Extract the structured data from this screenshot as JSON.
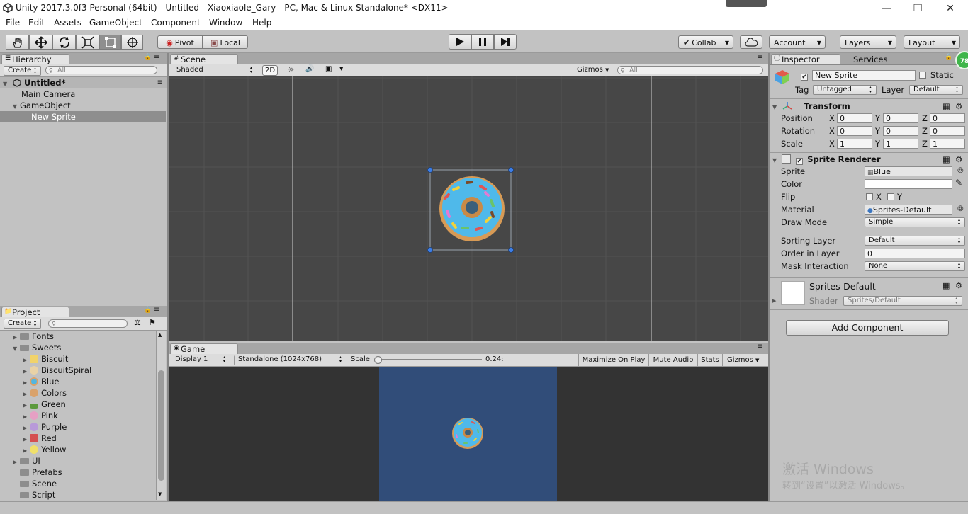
{
  "window": {
    "title": "Unity 2017.3.0f3 Personal (64bit) - Untitled - Xiaoxiaole_Gary - PC, Mac & Linux Standalone* <DX11>",
    "minimize": "—",
    "maximize": "❐",
    "close": "✕"
  },
  "menu": [
    "File",
    "Edit",
    "Assets",
    "GameObject",
    "Component",
    "Window",
    "Help"
  ],
  "toolbar": {
    "pivot": "Pivot",
    "local": "Local",
    "collab": "Collab",
    "account": "Account",
    "layers": "Layers",
    "layout": "Layout"
  },
  "hierarchy": {
    "tab": "Hierarchy",
    "create": "Create",
    "search_placeholder": "All",
    "scene_name": "Untitled*",
    "items": [
      {
        "label": "Main Camera"
      },
      {
        "label": "GameObject"
      },
      {
        "label": "New Sprite"
      }
    ]
  },
  "scene": {
    "tab": "Scene",
    "shading": "Shaded",
    "mode_2d": "2D",
    "gizmos": "Gizmos",
    "search_placeholder": "All"
  },
  "game": {
    "tab": "Game",
    "display": "Display 1",
    "resolution": "Standalone (1024x768)",
    "scale_label": "Scale",
    "scale_value": "0.24:",
    "maximize_on_play": "Maximize On Play",
    "mute_audio": "Mute Audio",
    "stats": "Stats",
    "gizmos": "Gizmos"
  },
  "project": {
    "tab": "Project",
    "create": "Create",
    "items": [
      {
        "label": "Fonts"
      },
      {
        "label": "Sweets"
      },
      {
        "label": "Biscuit",
        "color": "#f1d36a"
      },
      {
        "label": "BiscuitSpiral",
        "color": "#e9d2a6"
      },
      {
        "label": "Blue",
        "color": "#52b6e0"
      },
      {
        "label": "Colors",
        "color": "#d9a26b"
      },
      {
        "label": "Green",
        "color": "#5c9a3c"
      },
      {
        "label": "Pink",
        "color": "#e6a0c4"
      },
      {
        "label": "Purple",
        "color": "#b89ad9"
      },
      {
        "label": "Red",
        "color": "#d45050"
      },
      {
        "label": "Yellow",
        "color": "#f0e06a"
      },
      {
        "label": "UI"
      },
      {
        "label": "Prefabs"
      },
      {
        "label": "Scene"
      },
      {
        "label": "Script"
      }
    ]
  },
  "inspector": {
    "tab": "Inspector",
    "services_tab": "Services",
    "object_name": "New Sprite",
    "static_label": "Static",
    "tag_label": "Tag",
    "tag_value": "Untagged",
    "layer_label": "Layer",
    "layer_value": "Default",
    "badge": "78",
    "transform": {
      "title": "Transform",
      "position_label": "Position",
      "rotation_label": "Rotation",
      "scale_label": "Scale",
      "x": "X",
      "y": "Y",
      "z": "Z",
      "position": [
        "0",
        "0",
        "0"
      ],
      "rotation": [
        "0",
        "0",
        "0"
      ],
      "scale": [
        "1",
        "1",
        "1"
      ]
    },
    "sprite_renderer": {
      "title": "Sprite Renderer",
      "sprite_label": "Sprite",
      "sprite_value": "Blue",
      "color_label": "Color",
      "color_value": "#ffffff",
      "flip_label": "Flip",
      "flip_x": "X",
      "flip_y": "Y",
      "material_label": "Material",
      "material_value": "Sprites-Default",
      "draw_mode_label": "Draw Mode",
      "draw_mode_value": "Simple",
      "sorting_layer_label": "Sorting Layer",
      "sorting_layer_value": "Default",
      "order_label": "Order in Layer",
      "order_value": "0",
      "mask_label": "Mask Interaction",
      "mask_value": "None"
    },
    "material": {
      "name": "Sprites-Default",
      "shader_label": "Shader",
      "shader_value": "Sprites/Default"
    },
    "add_component": "Add Component"
  },
  "watermark": {
    "line1": "激活 Windows",
    "line2": "转到“设置”以激活 Windows。"
  },
  "colors": {
    "scene_bg": "#474747",
    "game_bg": "#333333",
    "game_camera_bg": "#314d79",
    "panel": "#c2c2c2",
    "selection": "#8e8e8e"
  }
}
